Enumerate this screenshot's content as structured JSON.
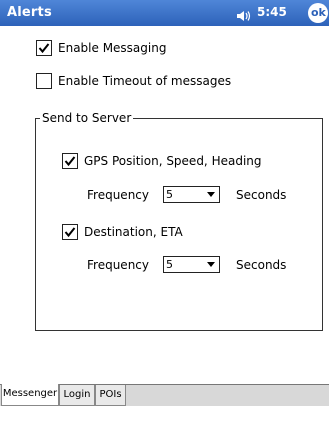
{
  "titlebar": {
    "title": "Alerts",
    "time": "5:45",
    "ok_label": "ok",
    "speaker_icon": "speaker-icon"
  },
  "options": {
    "enable_messaging": {
      "label": "Enable Messaging",
      "checked": true
    },
    "enable_timeout": {
      "label": "Enable Timeout of messages",
      "checked": false
    }
  },
  "send_to_server": {
    "legend": "Send to Server",
    "gps": {
      "label": "GPS Position, Speed, Heading",
      "checked": true,
      "frequency_label": "Frequency",
      "frequency_value": "5",
      "unit": "Seconds"
    },
    "destination": {
      "label": "Destination, ETA",
      "checked": true,
      "frequency_label": "Frequency",
      "frequency_value": "5",
      "unit": "Seconds"
    }
  },
  "tabs": [
    {
      "label": "Messenger",
      "active": true
    },
    {
      "label": "Login",
      "active": false
    },
    {
      "label": "POIs",
      "active": false
    }
  ],
  "colors": {
    "titlebar": "#2d62b9",
    "background": "#ffffff"
  }
}
